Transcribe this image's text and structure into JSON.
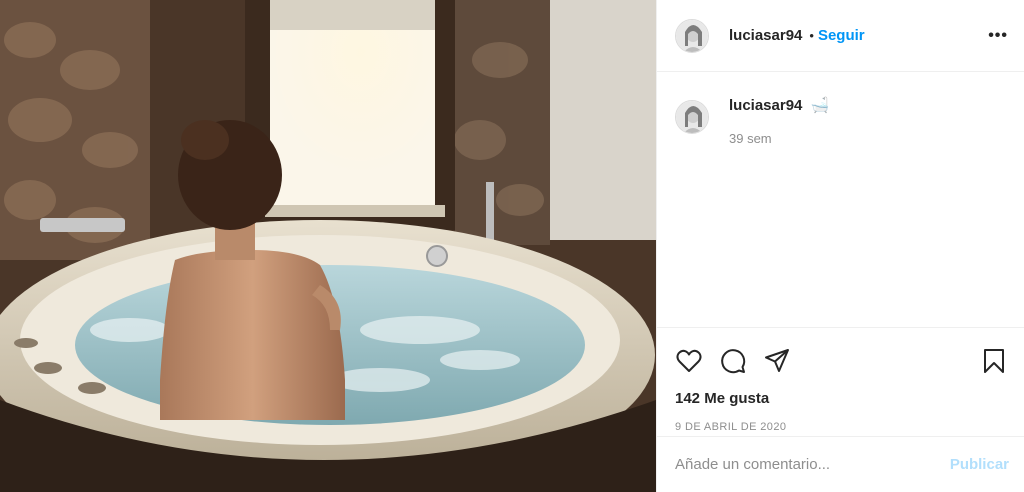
{
  "post": {
    "image_alt": "photo-jacuzzi",
    "author": "luciasar94",
    "follow_label": "Seguir",
    "dot": "•",
    "more_label": "•••",
    "caption_emoji": "🛁",
    "time_ago": "39 sem",
    "likes_text": "142 Me gusta",
    "date_text": "9 DE ABRIL DE 2020"
  },
  "comment_box": {
    "placeholder": "Añade un comentario...",
    "publish_label": "Publicar"
  },
  "icons": [
    "heart-icon",
    "comment-icon",
    "share-icon",
    "bookmark-icon",
    "more-icon"
  ],
  "colors": {
    "accent": "#0095f6",
    "publish_disabled": "#b2dffc",
    "muted": "#8e8e8e"
  }
}
